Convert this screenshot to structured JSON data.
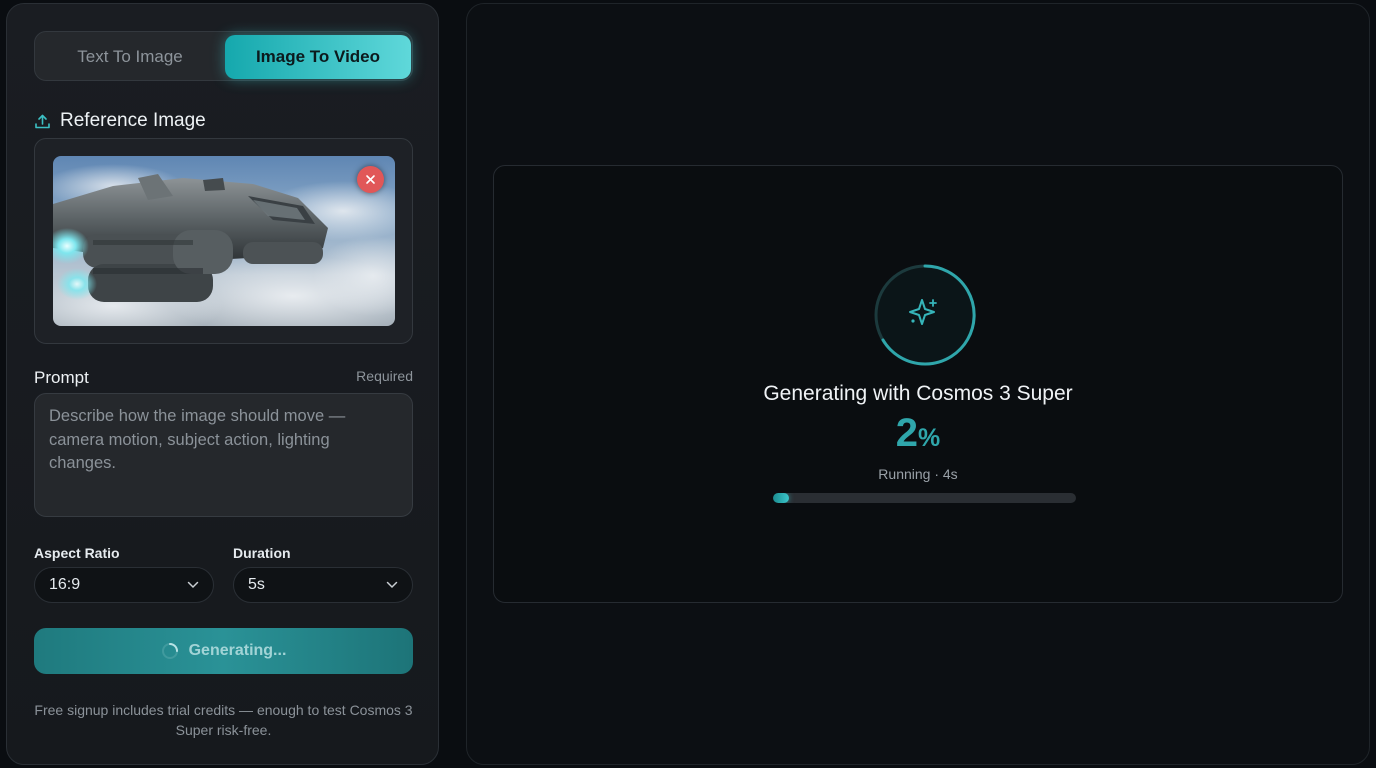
{
  "tabs": {
    "text_to_image": "Text To Image",
    "image_to_video": "Image To Video",
    "active": "image_to_video"
  },
  "reference": {
    "label": "Reference Image",
    "icon": "upload-icon",
    "remove_icon": "close-icon"
  },
  "prompt": {
    "label": "Prompt",
    "required": "Required",
    "placeholder": "Describe how the image should move — camera motion, subject action, lighting changes.",
    "value": ""
  },
  "aspect_ratio": {
    "label": "Aspect Ratio",
    "value": "16:9"
  },
  "duration": {
    "label": "Duration",
    "value": "5s"
  },
  "generate_button": {
    "label": "Generating..."
  },
  "footnote": "Free signup includes trial credits — enough to test Cosmos 3 Super risk-free.",
  "progress": {
    "title": "Generating with Cosmos 3 Super",
    "percent": "2",
    "percent_unit": "%",
    "status": "Running · 4s",
    "fraction": 0.02,
    "icon": "sparkle-icon"
  },
  "colors": {
    "accent": "#2fa6ab",
    "accent_light": "#5fd8da",
    "danger": "#e15758",
    "panel": "#1a1d22",
    "background": "#0a0d11"
  }
}
